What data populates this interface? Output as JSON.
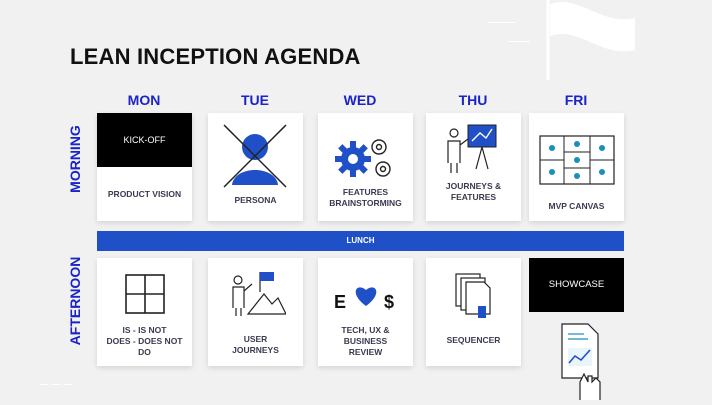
{
  "title": "LEAN INCEPTION AGENDA",
  "days": [
    "MON",
    "TUE",
    "WED",
    "THU",
    "FRI"
  ],
  "periods": {
    "morning": "MORNING",
    "afternoon": "AFTERNOON"
  },
  "lunch": "LUNCH",
  "morning": {
    "mon": {
      "header": "KICK-OFF",
      "label": "PRODUCT VISION"
    },
    "tue": {
      "label": "PERSONA",
      "icon": "persona-crossed-icon"
    },
    "wed": {
      "label": "FEATURES\nBRAINSTORMING",
      "icon": "gears-icon"
    },
    "thu": {
      "label": "JOURNEYS &\nFEATURES",
      "icon": "presenter-whiteboard-icon"
    },
    "fri": {
      "label": "MVP CANVAS",
      "icon": "canvas-grid-icon"
    }
  },
  "afternoon": {
    "mon": {
      "label": "IS - IS NOT\nDOES - DOES NOT\nDO",
      "icon": "four-square-grid-icon"
    },
    "tue": {
      "label": "USER\nJOURNEYS",
      "icon": "person-flag-mountain-icon"
    },
    "wed": {
      "label": "TECH, UX  &\nBUSINESS\nREVIEW",
      "icon": "e-heart-dollar-icon",
      "e_glyph": "E",
      "dollar_glyph": "$"
    },
    "thu": {
      "label": "SEQUENCER",
      "icon": "stacked-documents-icon"
    },
    "fri": {
      "header": "SHOWCASE",
      "icon": "hand-holding-report-icon"
    }
  },
  "colors": {
    "accent": "#1a23c8",
    "lunch_bar": "#1f50c8",
    "icon_blue": "#1f50c8",
    "background": "#f1f1f2"
  }
}
